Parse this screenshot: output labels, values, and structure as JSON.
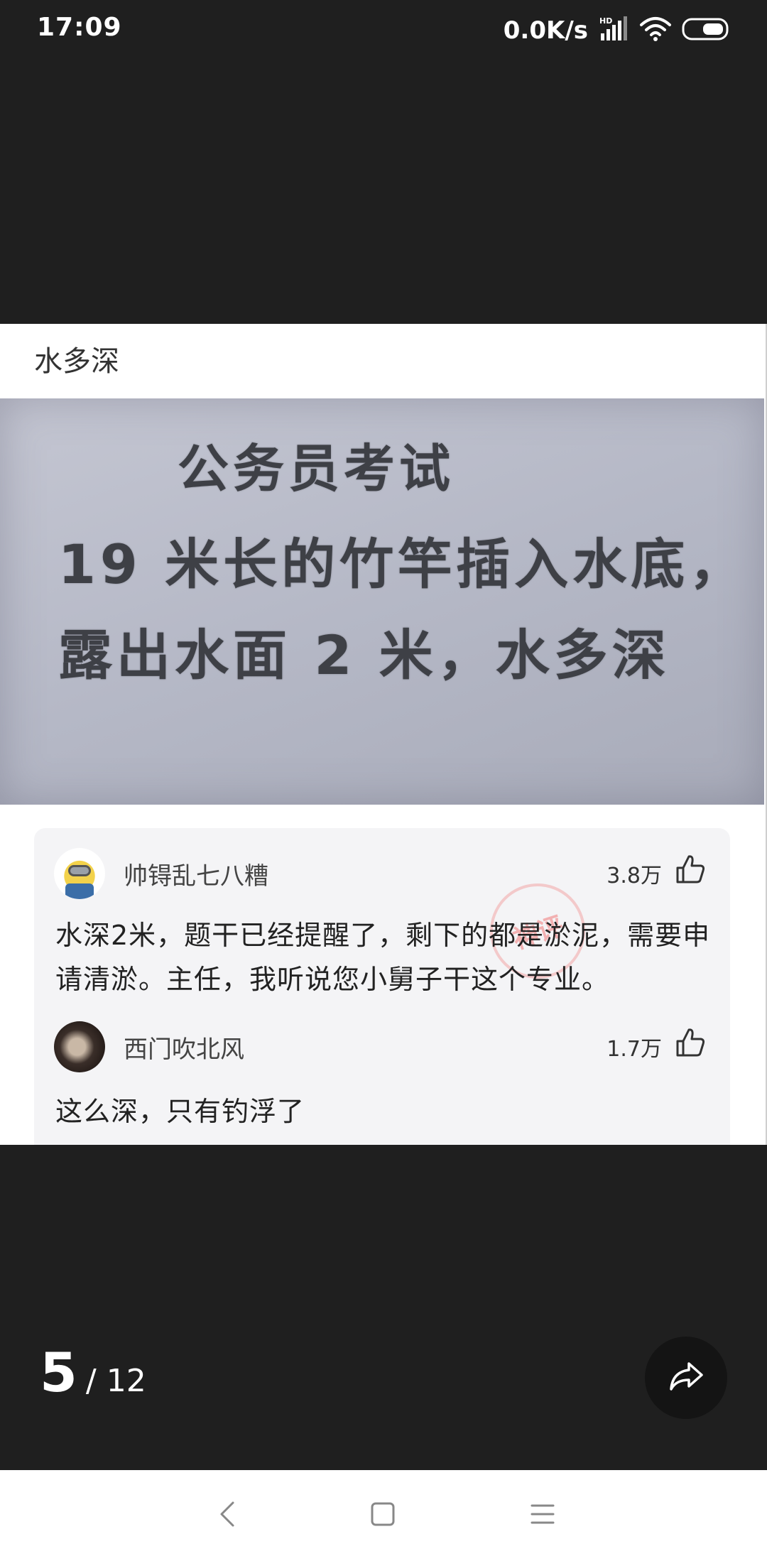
{
  "status_bar": {
    "time": "17:09",
    "net_speed": "0.0K/s",
    "signal_label": "HD",
    "icons": [
      "signal-icon",
      "wifi-icon",
      "battery-icon"
    ]
  },
  "post": {
    "title": "水多深",
    "image_text": {
      "line1": "公务员考试",
      "line2": "19 米长的竹竿插入水底，",
      "line3": "露出水面 2 米，水多深"
    },
    "comments": [
      {
        "username": "帅锝乱七八糟",
        "likes": "3.8万",
        "text": "水深2米，题干已经提醒了，剩下的都是淤泥，需要申请清淤。主任，我听说您小舅子干这个专业。",
        "badge": "神评"
      },
      {
        "username": "西门吹北风",
        "likes": "1.7万",
        "text": "这么深，只有钓浮了"
      }
    ]
  },
  "pager": {
    "current": "5",
    "total": "/ 12"
  },
  "colors": {
    "background": "#1f1f1f",
    "card": "#ffffff",
    "comment_bg": "#f4f4f6",
    "badge": "#f07878"
  }
}
